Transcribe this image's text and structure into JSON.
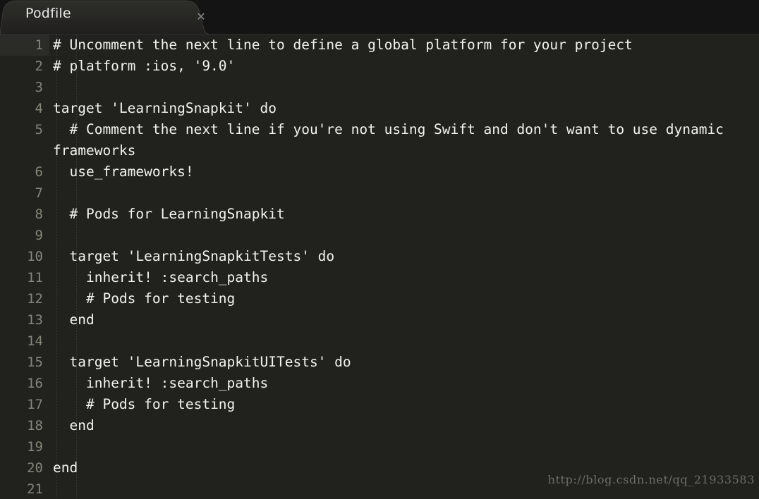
{
  "window": {
    "title": "Podfile",
    "background_color": "#21211e",
    "tabbar_color": "#141414",
    "tab_color": "#242421",
    "text_color": "#f2f2ee",
    "gutter_text_color": "#85857a",
    "current_line_gutter_color": "#2b2b27"
  },
  "tabbar": {
    "tabs": [
      {
        "label": "Podfile",
        "close_icon": "close-icon",
        "close_glyph": "✕",
        "active": true
      }
    ]
  },
  "editor": {
    "language": "ruby",
    "current_line": 1,
    "wrap_enabled": true,
    "indent_guides": true,
    "lines": [
      {
        "number": "1",
        "text": "# Uncomment the next line to define a global platform for your project",
        "current": true,
        "wrapped": false
      },
      {
        "number": "2",
        "text": "# platform :ios, '9.0'",
        "current": false,
        "wrapped": false
      },
      {
        "number": "3",
        "text": "",
        "current": false,
        "wrapped": false
      },
      {
        "number": "4",
        "text": "target 'LearningSnapkit' do",
        "current": false,
        "wrapped": false
      },
      {
        "number": "5",
        "text": "  # Comment the next line if you're not using Swift and don't want to use dynamic frameworks",
        "current": false,
        "wrapped": true
      },
      {
        "number": "6",
        "text": "  use_frameworks!",
        "current": false,
        "wrapped": false
      },
      {
        "number": "7",
        "text": "",
        "current": false,
        "wrapped": false
      },
      {
        "number": "8",
        "text": "  # Pods for LearningSnapkit",
        "current": false,
        "wrapped": false
      },
      {
        "number": "9",
        "text": "",
        "current": false,
        "wrapped": false
      },
      {
        "number": "10",
        "text": "  target 'LearningSnapkitTests' do",
        "current": false,
        "wrapped": false
      },
      {
        "number": "11",
        "text": "    inherit! :search_paths",
        "current": false,
        "wrapped": false
      },
      {
        "number": "12",
        "text": "    # Pods for testing",
        "current": false,
        "wrapped": false
      },
      {
        "number": "13",
        "text": "  end",
        "current": false,
        "wrapped": false
      },
      {
        "number": "14",
        "text": "",
        "current": false,
        "wrapped": false
      },
      {
        "number": "15",
        "text": "  target 'LearningSnapkitUITests' do",
        "current": false,
        "wrapped": false
      },
      {
        "number": "16",
        "text": "    inherit! :search_paths",
        "current": false,
        "wrapped": false
      },
      {
        "number": "17",
        "text": "    # Pods for testing",
        "current": false,
        "wrapped": false
      },
      {
        "number": "18",
        "text": "  end",
        "current": false,
        "wrapped": false
      },
      {
        "number": "19",
        "text": "",
        "current": false,
        "wrapped": false
      },
      {
        "number": "20",
        "text": "end",
        "current": false,
        "wrapped": false
      },
      {
        "number": "21",
        "text": "",
        "current": false,
        "wrapped": false
      }
    ]
  },
  "watermark": {
    "text": "http://blog.csdn.net/qq_21933583"
  }
}
